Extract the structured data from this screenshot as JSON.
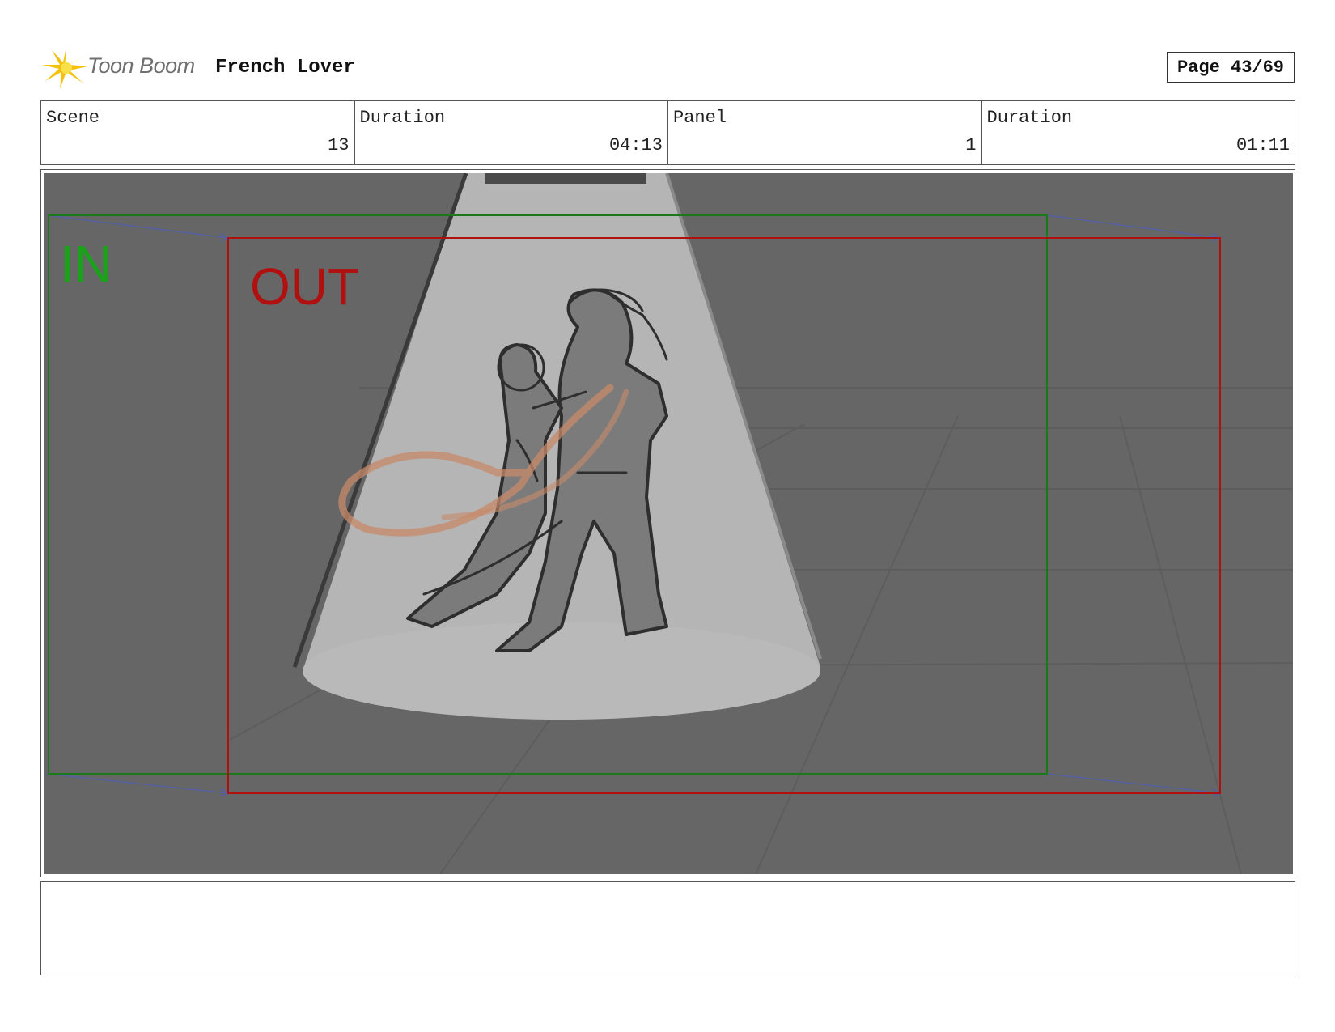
{
  "header": {
    "logo_text": "Toon Boom",
    "title": "French Lover",
    "page": "Page 43/69"
  },
  "info": {
    "scene_label": "Scene",
    "scene_value": "13",
    "scene_duration_label": "Duration",
    "scene_duration_value": "04:13",
    "panel_label": "Panel",
    "panel_value": "1",
    "panel_duration_label": "Duration",
    "panel_duration_value": "01:11"
  },
  "panel": {
    "camera_in_label": "IN",
    "camera_out_label": "OUT",
    "colors": {
      "background": "#666666",
      "spotlight": "#b4b4b4",
      "camera_in": "#1a7a1a",
      "camera_out": "#b01010",
      "motion_arrows": "#5560a0",
      "motion_swirl": "#c88a6a"
    }
  },
  "notes": {
    "text": ""
  }
}
